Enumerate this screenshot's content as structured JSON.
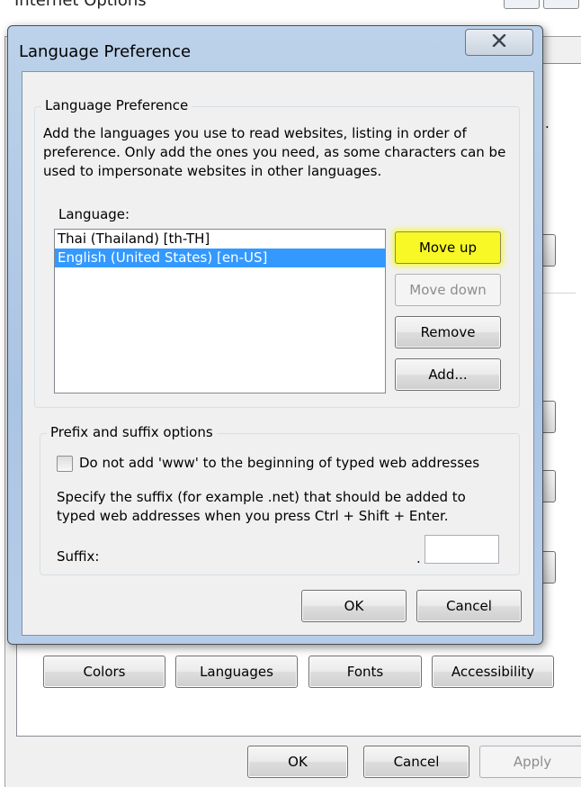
{
  "background_window": {
    "title": "Internet Options",
    "stub_dot": ".",
    "buttons": {
      "colors": "Colors",
      "languages": "Languages",
      "fonts": "Fonts",
      "accessibility": "Accessibility",
      "ok": "OK",
      "cancel": "Cancel",
      "apply": "Apply"
    }
  },
  "dialog": {
    "title": "Language Preference",
    "close_glyph": "X",
    "language_group": {
      "legend": "Language Preference",
      "description": "Add the languages you use to read websites, listing in order of preference. Only add the ones you need, as some characters can be used to impersonate websites in other languages.",
      "list_label": "Language:",
      "languages": [
        {
          "label": "Thai (Thailand) [th-TH]",
          "selected": false
        },
        {
          "label": "English (United States) [en-US]",
          "selected": true
        }
      ],
      "buttons": {
        "move_up": "Move up",
        "move_down": "Move down",
        "remove": "Remove",
        "add": "Add..."
      }
    },
    "prefix_group": {
      "legend": "Prefix and suffix options",
      "checkbox_label": "Do not add 'www' to the beginning of typed web addresses",
      "checkbox_checked": false,
      "suffix_help": "Specify the suffix (for example .net) that should be added to typed web addresses when you press Ctrl + Shift + Enter.",
      "suffix_label": "Suffix:",
      "suffix_dot": ".",
      "suffix_value": ""
    },
    "footer": {
      "ok": "OK",
      "cancel": "Cancel"
    }
  },
  "colors": {
    "highlight": "#f8f826",
    "selection": "#3399ff",
    "dialog_frame": "#aac4e3"
  }
}
